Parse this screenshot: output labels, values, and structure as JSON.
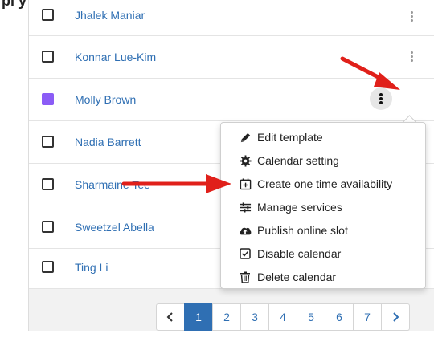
{
  "heading_fragment": "pl          y",
  "rows": [
    {
      "name": "Jhalek Maniar",
      "checkbox": "unchecked"
    },
    {
      "name": "Konnar Lue-Kim",
      "checkbox": "unchecked"
    },
    {
      "name": "Molly Brown",
      "checkbox": "filled",
      "checkbox_color": "#8b5cf6"
    },
    {
      "name": "Nadia Barrett",
      "checkbox": "unchecked"
    },
    {
      "name": "Sharmaine Tee",
      "checkbox": "unchecked"
    },
    {
      "name": "Sweetzel Abella",
      "checkbox": "unchecked"
    },
    {
      "name": "Ting Li",
      "checkbox": "unchecked"
    }
  ],
  "context_menu": {
    "items": [
      {
        "label": "Edit template",
        "icon": "pencil-icon"
      },
      {
        "label": "Calendar setting",
        "icon": "cog-icon"
      },
      {
        "label": "Create one time availability",
        "icon": "calendar-plus-icon"
      },
      {
        "label": "Manage services",
        "icon": "sliders-icon"
      },
      {
        "label": "Publish online slot",
        "icon": "cloud-upload-icon"
      },
      {
        "label": "Disable calendar",
        "icon": "checkbox-square-icon"
      },
      {
        "label": "Delete calendar",
        "icon": "trash-icon"
      }
    ]
  },
  "pagination": {
    "prev": "chevron-left-icon",
    "pages": [
      "1",
      "2",
      "3",
      "4",
      "5",
      "6",
      "7"
    ],
    "current": "1",
    "next": "chevron-right-icon"
  },
  "colors": {
    "link": "#2f6fb3",
    "accent_active_page": "#2f6fb3",
    "annotation_arrow": "#e0201a",
    "molly_checkbox": "#8b5cf6"
  }
}
